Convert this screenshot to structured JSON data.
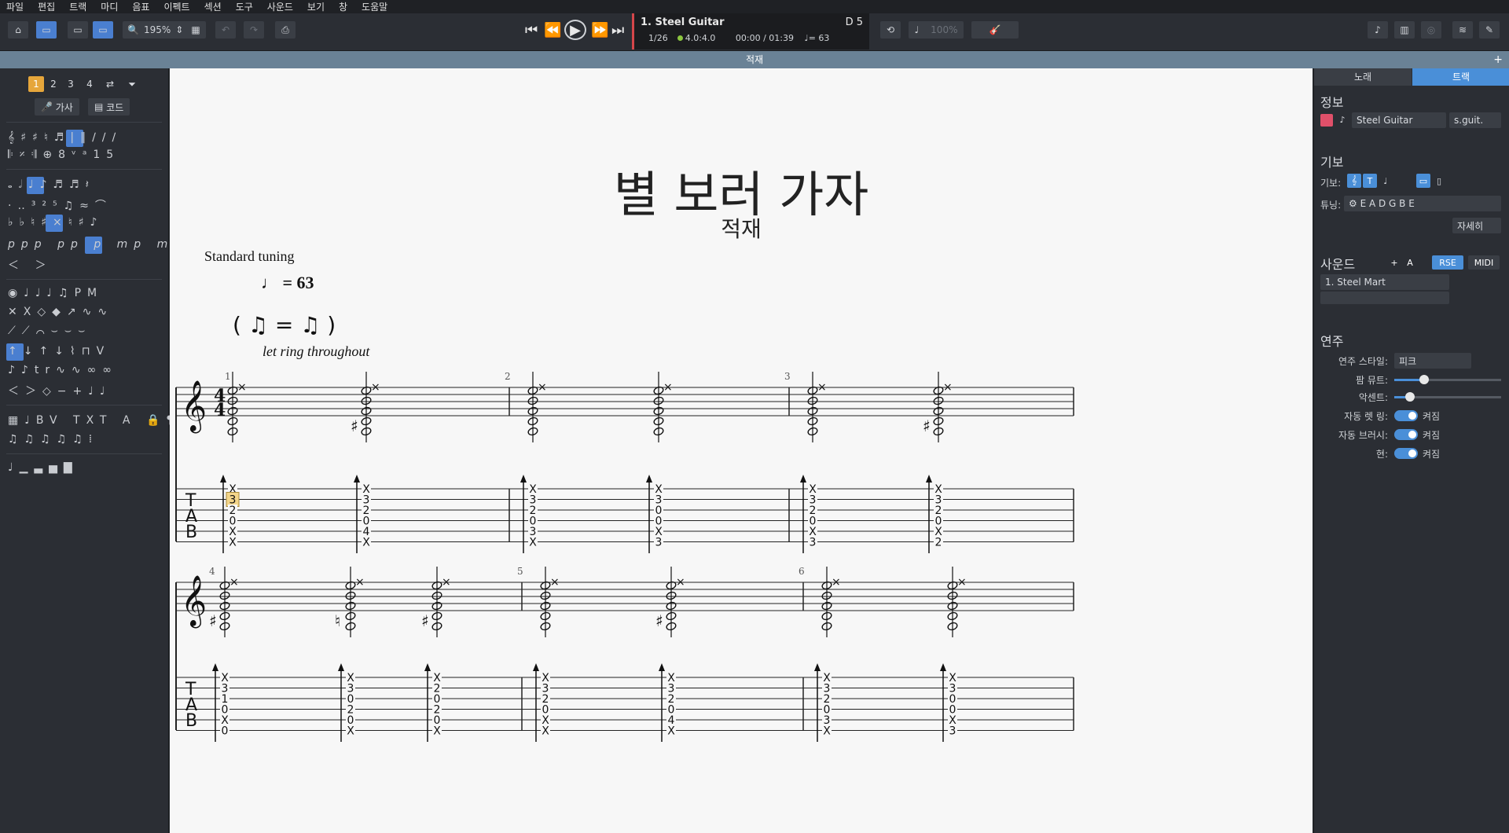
{
  "menu": [
    "파일",
    "편집",
    "트랙",
    "마디",
    "음표",
    "이펙트",
    "섹션",
    "도구",
    "사운드",
    "보기",
    "창",
    "도움말"
  ],
  "toolbar": {
    "zoom": "195%",
    "lcd": {
      "track": "1. Steel Guitar",
      "position": "1/26",
      "signature": "4.0:4.0",
      "time": "00:00 / 01:39",
      "tempo": "♩= 63",
      "key": "D 5"
    },
    "speed": "100%"
  },
  "document_tab": "적재",
  "palette": {
    "pages": [
      "1",
      "2",
      "3",
      "4"
    ],
    "lyrics_button": "가사",
    "chord_button": "코드"
  },
  "score": {
    "title": "별 보러 가자",
    "subtitle": "적재",
    "tuning": "Standard tuning",
    "tempo_marking": "= 63",
    "instruction": "let ring throughout",
    "systems": [
      {
        "bars": [
          {
            "number": "1",
            "beats": [
              {
                "tab": [
                  "X",
                  "3",
                  "2",
                  "0",
                  "X",
                  "X"
                ],
                "accidental": ""
              },
              {
                "tab": [
                  "X",
                  "3",
                  "2",
                  "0",
                  "4",
                  "X"
                ],
                "accidental": "♯"
              }
            ]
          },
          {
            "number": "2",
            "beats": [
              {
                "tab": [
                  "X",
                  "3",
                  "2",
                  "0",
                  "3",
                  "X"
                ],
                "accidental": ""
              },
              {
                "tab": [
                  "X",
                  "3",
                  "0",
                  "0",
                  "X",
                  "3"
                ],
                "accidental": ""
              }
            ]
          },
          {
            "number": "3",
            "beats": [
              {
                "tab": [
                  "X",
                  "3",
                  "2",
                  "0",
                  "X",
                  "3"
                ],
                "accidental": ""
              },
              {
                "tab": [
                  "X",
                  "3",
                  "2",
                  "0",
                  "X",
                  "2"
                ],
                "accidental": "♯"
              }
            ]
          }
        ]
      },
      {
        "bars": [
          {
            "number": "4",
            "beats": [
              {
                "tab": [
                  "X",
                  "3",
                  "1",
                  "0",
                  "X",
                  "0"
                ],
                "accidental": "♯"
              },
              {
                "tab": [
                  "X",
                  "3",
                  "0",
                  "2",
                  "0",
                  "X"
                ],
                "accidental": "♮"
              },
              {
                "tab": [
                  "X",
                  "2",
                  "0",
                  "2",
                  "0",
                  "X"
                ],
                "accidental": "♯"
              }
            ]
          },
          {
            "number": "5",
            "beats": [
              {
                "tab": [
                  "X",
                  "3",
                  "2",
                  "0",
                  "X",
                  "X"
                ],
                "accidental": ""
              },
              {
                "tab": [
                  "X",
                  "3",
                  "2",
                  "0",
                  "4",
                  "X"
                ],
                "accidental": "♯"
              }
            ]
          },
          {
            "number": "6",
            "beats": [
              {
                "tab": [
                  "X",
                  "3",
                  "2",
                  "0",
                  "3",
                  "X"
                ],
                "accidental": ""
              },
              {
                "tab": [
                  "X",
                  "3",
                  "0",
                  "0",
                  "X",
                  "3"
                ],
                "accidental": ""
              }
            ]
          }
        ]
      }
    ],
    "selected_fret": "3"
  },
  "right_panel": {
    "tabs": [
      "노래",
      "트랙"
    ],
    "info_header": "정보",
    "track_name": "Steel Guitar",
    "track_short": "s.guit.",
    "notation_header": "기보",
    "notation_label": "기보:",
    "tuning_label": "튜닝:",
    "tuning_value": "E A D G B E",
    "details_button": "자세히",
    "sound_header": "사운드",
    "rse_label": "RSE",
    "midi_label": "MIDI",
    "sound_name": "1. Steel Mart",
    "play_header": "연주",
    "play_style_label": "연주 스타일:",
    "play_style_value": "피크",
    "palm_mute_label": "팜 뮤트:",
    "palm_mute_level": 0.28,
    "accent_label": "악센트:",
    "accent_level": 0.15,
    "auto_let_ring_label": "자동 렛 링:",
    "auto_brush_label": "자동 브러시:",
    "string_label": "현:",
    "on_label": "켜짐",
    "colors": {
      "track_color": "#e0506a",
      "accent": "#4a8fd8"
    }
  }
}
